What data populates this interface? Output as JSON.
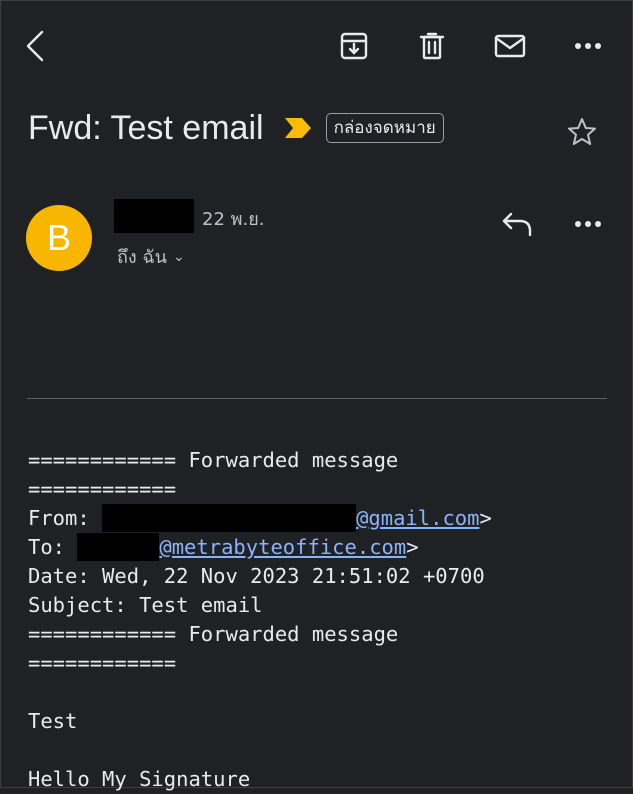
{
  "toolbar": {
    "back_icon": "arrow-back-icon",
    "archive_icon": "archive-icon",
    "delete_icon": "trash-icon",
    "mark_unread_icon": "mail-icon",
    "more_icon": "more-horiz-icon"
  },
  "email": {
    "subject": "Fwd: Test email",
    "label": "กล่องจดหมาย",
    "date": "22 พ.ย.",
    "to_me": "ถึง ฉัน",
    "avatar_letter": "B"
  },
  "colors": {
    "background": "#202124",
    "avatar": "#f9b600",
    "link": "#8ab4f8",
    "importance": "#fbbc04"
  },
  "body": {
    "fwd_header_1": "============ Forwarded message",
    "fwd_header_2": "============",
    "from_label": "From: ",
    "from_email_suffix": "@gmail.com",
    "from_close": ">",
    "to_label": "To: ",
    "to_email_suffix": "@metrabyteoffice.com",
    "to_close": ">",
    "date_line": "Date: Wed, 22 Nov 2023 21:51:02 +0700",
    "subject_line": "Subject: Test email",
    "fwd_footer_1": "============ Forwarded message",
    "fwd_footer_2": "============",
    "text": "Test",
    "signature": "Hello My Signature"
  }
}
